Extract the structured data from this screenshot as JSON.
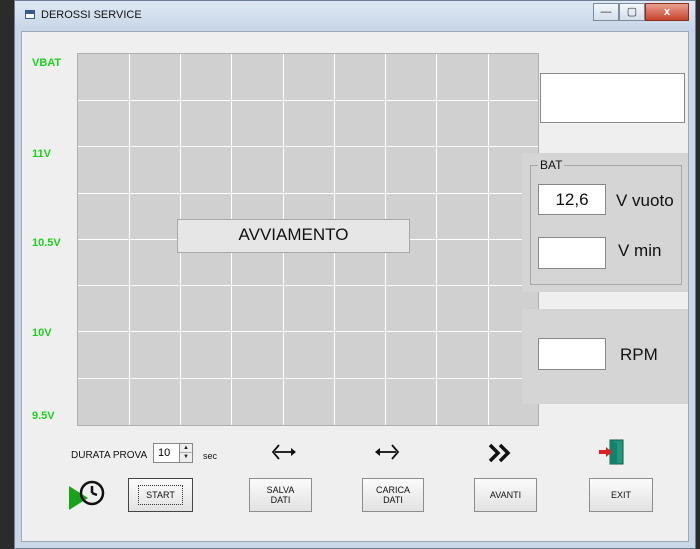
{
  "window": {
    "title": "DEROSSI SERVICE"
  },
  "titlebar_buttons": {
    "minimize": "—",
    "maximize": "▢",
    "close": "x"
  },
  "chart": {
    "y_labels": [
      "VBAT",
      "11V",
      "10.5V",
      "10V",
      "9.5V"
    ],
    "mode_label": "AVVIAMENTO"
  },
  "bat": {
    "legend": "BAT",
    "v_vuoto_value": "12,6",
    "v_vuoto_unit": "V vuoto",
    "v_min_value": "",
    "v_min_unit": "V min"
  },
  "rpm": {
    "value": "",
    "unit": "RPM"
  },
  "durata": {
    "label": "DURATA PROVA",
    "value": "10",
    "unit": "sec"
  },
  "buttons": {
    "start": "START",
    "salva": "SALVA\nDATI",
    "carica": "CARICA\nDATI",
    "avanti": "AVANTI",
    "exit": "EXIT"
  },
  "icons": [
    "timer-play-icon",
    "save-data-icon",
    "load-data-icon",
    "forward-icon",
    "exit-door-icon"
  ],
  "colors": {
    "y_label": "#1fcf1f",
    "grid_bg": "#d0d0d0",
    "play_green": "#1aa31a",
    "exit_red": "#e02020",
    "door_green": "#1f9a7a"
  }
}
